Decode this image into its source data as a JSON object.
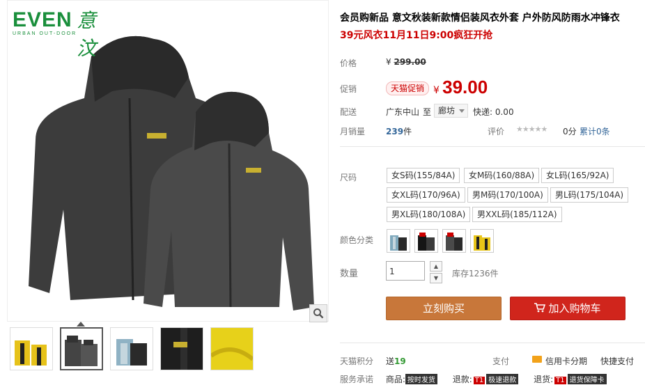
{
  "gallery": {
    "brand_logo": "EVEN",
    "brand_script": "意汶",
    "brand_subline": "URBAN OUT-DOOR",
    "zoom_icon": "magnifier-icon",
    "thumbnails": [
      {
        "name": "thumb-yellow-pair",
        "colors": [
          "#e6c21a",
          "#222222"
        ]
      },
      {
        "name": "thumb-dark-pair",
        "colors": [
          "#444444",
          "#333333"
        ],
        "active": true
      },
      {
        "name": "thumb-blue-pair",
        "colors": [
          "#8fb2c4",
          "#2a2a2a"
        ]
      },
      {
        "name": "thumb-detail-dark",
        "colors": [
          "#1e1e1e",
          "#c8b030"
        ]
      },
      {
        "name": "thumb-detail-yellow",
        "colors": [
          "#e7d11a",
          "#c7ad10"
        ]
      }
    ]
  },
  "product": {
    "title": "会员购新品 意文秋装新款情侣装风衣外套 户外防风防雨水冲锋衣",
    "promo_line": "39元风衣11月11日9:00疯狂开抢"
  },
  "price": {
    "label": "价格",
    "currency": "¥",
    "original": "299.00"
  },
  "promotion": {
    "label": "促销",
    "badge": "天猫促销",
    "currency": "¥",
    "price": "39.00"
  },
  "shipping": {
    "label": "配送",
    "from": "广东中山",
    "to_word": "至",
    "destination": "廊坊",
    "fee": "快递: 0.00"
  },
  "sales": {
    "label": "月销量",
    "count": "239",
    "unit": "件"
  },
  "review": {
    "label": "评价",
    "stars": "★★★★★",
    "score": "0分",
    "total": "累计0条"
  },
  "size": {
    "label": "尺码",
    "options": [
      "女S码(155/84A)",
      "女M码(160/88A)",
      "女L码(165/92A)",
      "女XL码(170/96A)",
      "男M码(170/100A)",
      "男L码(175/104A)",
      "男XL码(180/108A)",
      "男XXL码(185/112A)"
    ]
  },
  "color": {
    "label": "颜色分类",
    "swatches": [
      {
        "name": "swatch-blue",
        "colors": [
          "#7fa9bd",
          "#2a2a2a"
        ]
      },
      {
        "name": "swatch-black",
        "colors": [
          "#151515",
          "#3a3a3a"
        ]
      },
      {
        "name": "swatch-grey",
        "colors": [
          "#4a4a4a",
          "#2a2a2a"
        ]
      },
      {
        "name": "swatch-yellow",
        "colors": [
          "#e8c518",
          "#222222"
        ]
      }
    ]
  },
  "quantity": {
    "label": "数量",
    "value": "1",
    "up": "▲",
    "down": "▼",
    "stock": "库存1236件"
  },
  "actions": {
    "buy_now": "立刻购买",
    "add_cart": "加入购物车",
    "cart_icon": "cart-icon"
  },
  "points": {
    "label": "天猫积分",
    "prefix": "送",
    "value": "19"
  },
  "payment": {
    "label": "支付",
    "credit": "信用卡分期",
    "quick": "快捷支付"
  },
  "service": {
    "label": "服务承诺",
    "product_word": "商品:",
    "product_tag": "按时发货",
    "refund_word": "退款:",
    "refund_tag_prefix": "T1",
    "refund_tag": "极速退款",
    "return_word": "退货:",
    "return_tag_prefix": "T1",
    "return_tag": "退货保障卡"
  },
  "colors": {
    "price_red": "#cc0000",
    "buy_orange": "#c8773a",
    "cart_red": "#d0251c",
    "brand_green": "#1a8f3c",
    "link_blue": "#336699"
  }
}
